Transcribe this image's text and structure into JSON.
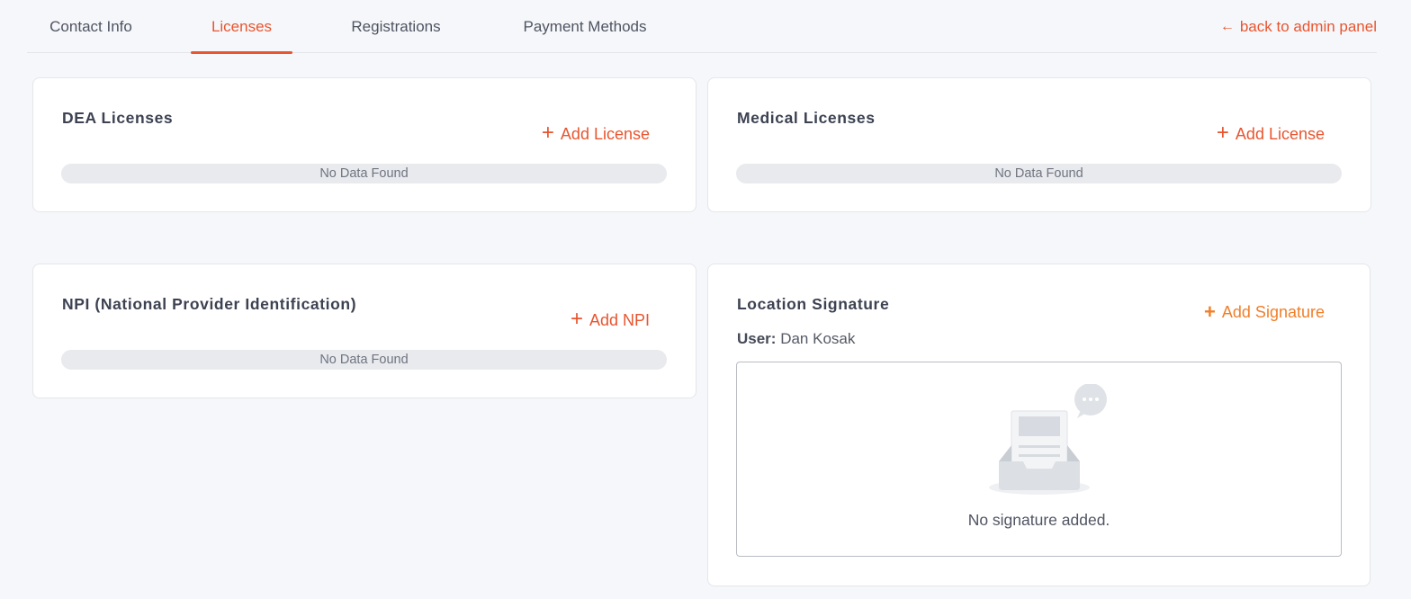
{
  "tabs": [
    {
      "label": "Contact Info",
      "active": false
    },
    {
      "label": "Licenses",
      "active": true
    },
    {
      "label": "Registrations",
      "active": false
    },
    {
      "label": "Payment Methods",
      "active": false
    }
  ],
  "back_link": {
    "label": "back to admin panel",
    "icon": "arrow-left-icon"
  },
  "colors": {
    "accent": "#e8552f",
    "signature_accent": "#f07f2a",
    "background": "#f6f7fa"
  },
  "dea": {
    "title": "DEA Licenses",
    "add_label": "Add License",
    "empty_text": "No Data Found"
  },
  "medical": {
    "title": "Medical Licenses",
    "add_label": "Add License",
    "empty_text": "No Data Found"
  },
  "npi": {
    "title": "NPI (National Provider Identification)",
    "add_label": "Add NPI",
    "empty_text": "No Data Found"
  },
  "signature": {
    "title": "Location Signature",
    "add_label": "Add Signature",
    "user_label": "User:",
    "user_name": "Dan Kosak",
    "empty_text": "No signature added.",
    "empty_icon": "empty-inbox-icon"
  }
}
